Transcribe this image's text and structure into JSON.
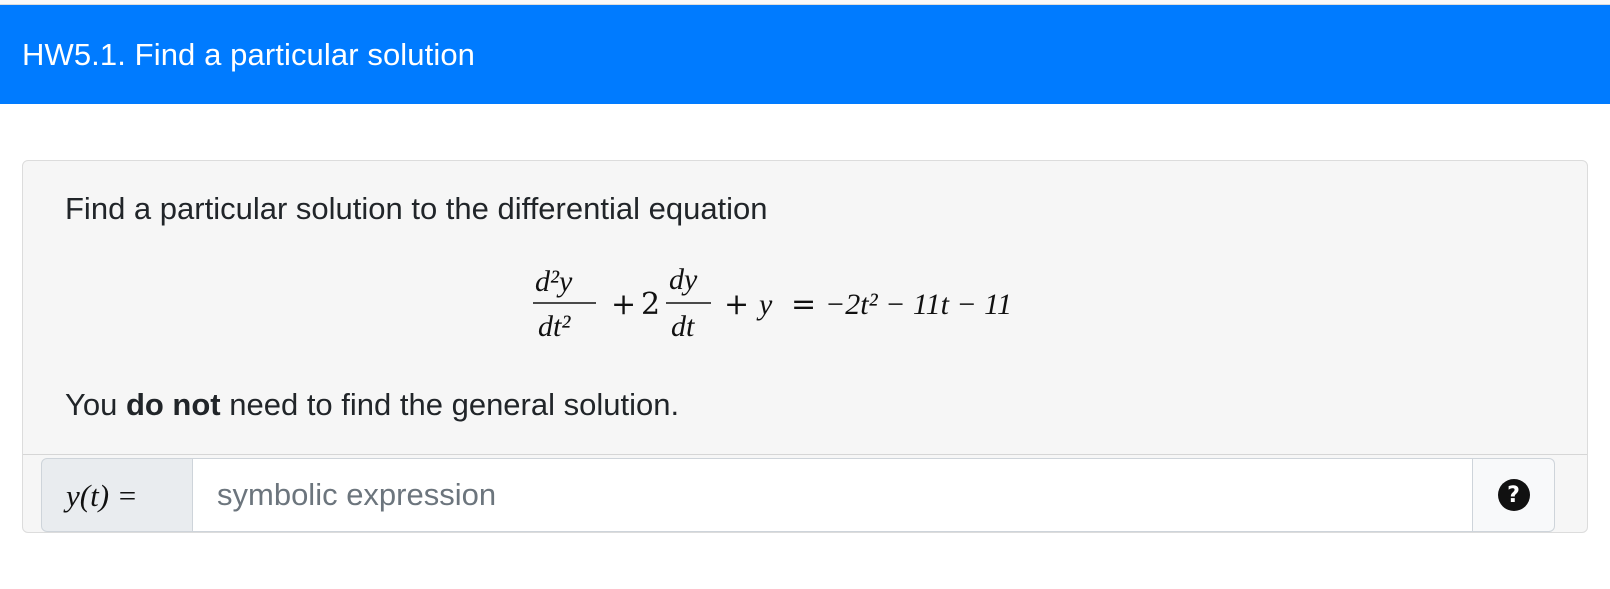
{
  "header": {
    "title": "HW5.1. Find a particular solution"
  },
  "question": {
    "prompt": "Find a particular solution to the differential equation",
    "equation": {
      "lhs_first_numerator": "d²y",
      "lhs_first_denominator": "dt²",
      "lhs_plus_1": "+",
      "lhs_coefficient": "2",
      "lhs_second_numerator": "dy",
      "lhs_second_denominator": "dt",
      "lhs_plus_2": "+",
      "lhs_y": "y",
      "equals": "=",
      "rhs": "−2t² − 11t − 11"
    },
    "note_prefix": "You ",
    "note_bold": "do not",
    "note_suffix": " need to find the general solution."
  },
  "answer": {
    "prefix_label": "y(t) =",
    "placeholder": "symbolic expression",
    "value": "",
    "help_icon": "question-circle-icon",
    "help_glyph": "?"
  }
}
